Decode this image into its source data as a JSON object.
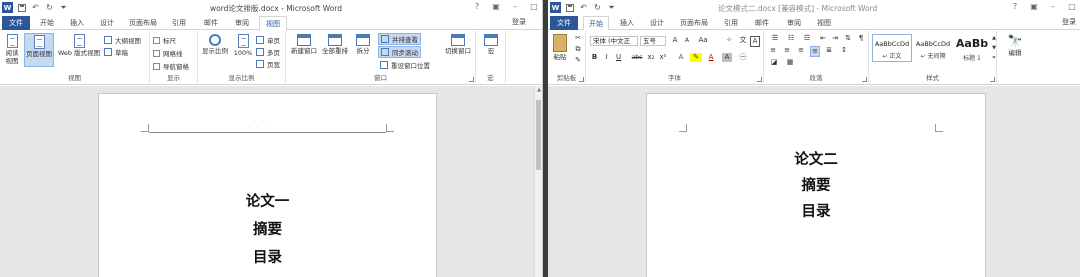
{
  "left": {
    "title": "word论文排版.docx - Microsoft Word",
    "tabs": [
      "文件",
      "开始",
      "插入",
      "设计",
      "页面布局",
      "引用",
      "邮件",
      "审阅",
      "视图"
    ],
    "active_tab": "视图",
    "login": "登录",
    "groups": {
      "views": {
        "label": "视图",
        "read_mode": "阅读视图",
        "print_layout": "页面视图",
        "web_layout": "Web 版式视图",
        "outline": "大纲视图",
        "draft": "草稿"
      },
      "show": {
        "label": "显示",
        "ruler": "标尺",
        "gridlines": "网格线",
        "nav_pane": "导航窗格"
      },
      "zoom": {
        "label": "显示比例",
        "zoom": "显示比例",
        "hundred": "100%",
        "one_page": "单页",
        "multi_page": "多页",
        "page_width": "页宽"
      },
      "window": {
        "label": "窗口",
        "new_window": "新建窗口",
        "arrange_all": "全部重排",
        "split": "拆分",
        "side_by_side": "并排查看",
        "sync_scroll": "同步滚动",
        "reset_position": "重设窗口位置",
        "switch_windows": "切换窗口"
      },
      "macros": {
        "label": "宏",
        "macros": "宏"
      }
    },
    "page_lines": [
      "论文一",
      "摘要",
      "目录"
    ]
  },
  "right": {
    "title": "论文模式二.docx [兼容模式] - Microsoft Word",
    "tabs": [
      "文件",
      "开始",
      "插入",
      "设计",
      "页面布局",
      "引用",
      "邮件",
      "审阅",
      "视图"
    ],
    "active_tab": "开始",
    "login": "登录",
    "groups": {
      "clipboard": {
        "label": "剪贴板",
        "paste": "粘贴"
      },
      "font": {
        "label": "字体",
        "font_name": "宋体 (中文正",
        "font_size": "五号",
        "buttons": [
          "B",
          "I",
          "U",
          "abc",
          "x₂",
          "x²",
          "A",
          "A",
          "Aa"
        ]
      },
      "paragraph": {
        "label": "段落"
      },
      "styles": {
        "label": "样式",
        "items": [
          {
            "sample": "AaBbCcDd",
            "name": "↵ 正文"
          },
          {
            "sample": "AaBbCcDd",
            "name": "↵ 无间隔"
          },
          {
            "sample": "AaBb",
            "name": "标题 1"
          }
        ]
      },
      "editing": {
        "label": "编辑"
      }
    },
    "page_lines": [
      "论文二",
      "摘要",
      "目录"
    ]
  }
}
